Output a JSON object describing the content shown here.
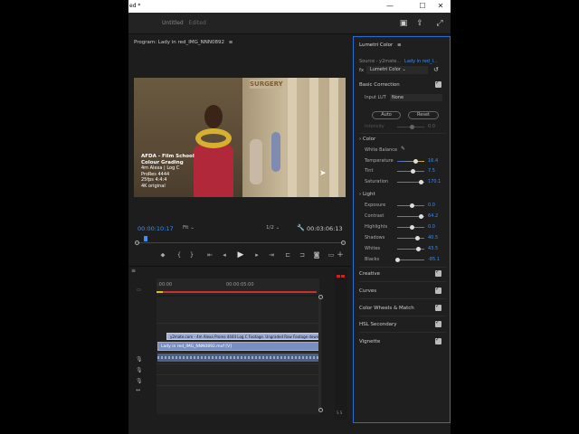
{
  "window": {
    "title": "ed *",
    "minimize": "—",
    "maximize": "☐",
    "close": "✕"
  },
  "header": {
    "project": "Untitled",
    "status": "Edited"
  },
  "program": {
    "label": "Program: Lady in red_IMG_NNN0892",
    "menu_icon": "≡"
  },
  "video_overlay": {
    "line1": "AFDA - Film School",
    "line2": "Colour Grading",
    "line3": "4m Alexa | Log C",
    "line4": "ProRes 4444",
    "line5": "25fps 4:4:4",
    "line6": "4K original"
  },
  "video_sign": "SURGERY",
  "playback": {
    "current_tc": "00:00:10:17",
    "zoom": "Fit",
    "resolution": "1/2",
    "duration_tc": "00:03:06:13"
  },
  "timeline": {
    "menu_icon": "≡",
    "t0": ":00:00",
    "t1": "00:00:05:00",
    "clip_v2": "y2mate.com - 4m Alexa Prores 4444 Log C Footage. Ungraded Raw Footage downl",
    "clip_v1": "Lady in red_IMG_NNN0892.mxf [V]",
    "meter_label": "S S"
  },
  "lumetri": {
    "title": "Lumetri Color",
    "source": "Source - y2mate...",
    "sequence": "Lady in red_I...",
    "fx_name": "Lumetri Color",
    "basic": "Basic Correction",
    "input_lut_label": "Input LUT",
    "input_lut_value": "None",
    "auto": "Auto",
    "reset": "Reset",
    "intensity_label": "Intensity",
    "intensity_value": "0.0",
    "color_section": "Color",
    "white_balance": "White Balance",
    "temperature_label": "Temperature",
    "temperature_value": "16.4",
    "tint_label": "Tint",
    "tint_value": "7.5",
    "saturation_label": "Saturation",
    "saturation_value": "170.1",
    "light_section": "Light",
    "exposure_label": "Exposure",
    "exposure_value": "0.0",
    "contrast_label": "Contrast",
    "contrast_value": "64.2",
    "highlights_label": "Highlights",
    "highlights_value": "0.0",
    "shadows_label": "Shadows",
    "shadows_value": "40.5",
    "whites_label": "Whites",
    "whites_value": "43.5",
    "blacks_label": "Blacks",
    "blacks_value": "-85.1",
    "creative": "Creative",
    "curves": "Curves",
    "wheels": "Color Wheels & Match",
    "hsl": "HSL Secondary",
    "vignette": "Vignette"
  }
}
